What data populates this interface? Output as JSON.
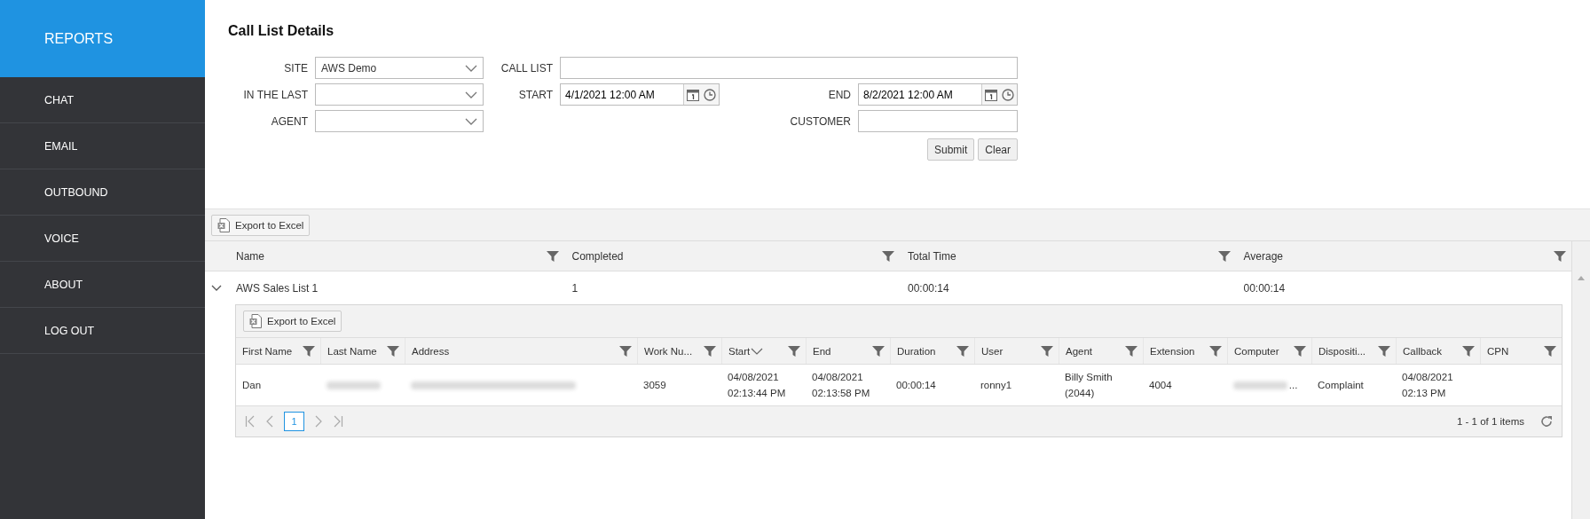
{
  "sidebar": {
    "header": "REPORTS",
    "items": [
      "CHAT",
      "EMAIL",
      "OUTBOUND",
      "VOICE",
      "ABOUT",
      "LOG OUT"
    ]
  },
  "title": "Call List Details",
  "form": {
    "site": {
      "label": "SITE",
      "value": "AWS Demo"
    },
    "in_the_last": {
      "label": "IN THE LAST"
    },
    "agent": {
      "label": "AGENT"
    },
    "call_list": {
      "label": "CALL LIST"
    },
    "start": {
      "label": "START",
      "value": "4/1/2021 12:00 AM"
    },
    "end": {
      "label": "END",
      "value": "8/2/2021 12:00 AM"
    },
    "customer": {
      "label": "CUSTOMER"
    },
    "buttons": [
      "Submit",
      "Clear"
    ]
  },
  "grid": {
    "export": "Export to Excel",
    "columns": [
      "Name",
      "Completed",
      "Total Time",
      "Average"
    ],
    "rows": [
      {
        "expanded": true,
        "cells": [
          "AWS Sales List 1",
          "1",
          "00:00:14",
          "00:00:14"
        ],
        "detail": {
          "export": "Export to Excel",
          "columns": [
            {
              "label": "First Name"
            },
            {
              "label": "Last Name"
            },
            {
              "label": "Address"
            },
            {
              "label": "Work Nu..."
            },
            {
              "label": "Start",
              "sort_descending": true
            },
            {
              "label": "End"
            },
            {
              "label": "Duration"
            },
            {
              "label": "User"
            },
            {
              "label": "Agent"
            },
            {
              "label": "Extension"
            },
            {
              "label": "Computer"
            },
            {
              "label": "Dispositi..."
            },
            {
              "label": "Callback"
            },
            {
              "label": "CPN"
            }
          ],
          "rows": [
            {
              "cells": [
                {
                  "text": "Dan"
                },
                {
                  "kind": "blurred"
                },
                {
                  "kind": "blurred"
                },
                {
                  "text": "3059"
                },
                {
                  "text": "04/08/2021 02:13:44 PM"
                },
                {
                  "text": "04/08/2021 02:13:58 PM"
                },
                {
                  "text": "00:00:14"
                },
                {
                  "text": "ronny1"
                },
                {
                  "text": "Billy Smith (2044)"
                },
                {
                  "text": "4004"
                },
                {
                  "kind": "blurred",
                  "text": "..."
                },
                {
                  "text": "Complaint"
                },
                {
                  "text": "04/08/2021 02:13 PM"
                },
                {
                  "kind": "empty"
                }
              ]
            }
          ],
          "pager": {
            "pages": [
              {
                "label": "1",
                "selected": true
              }
            ],
            "info": "1 - 1 of 1 items"
          }
        }
      }
    ]
  }
}
